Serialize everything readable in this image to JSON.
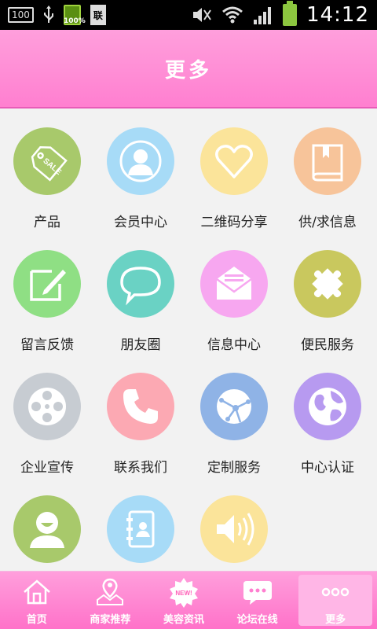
{
  "status_bar": {
    "badge": "100",
    "battery_small": "100%",
    "doc_label": "联",
    "time": "14:12"
  },
  "header": {
    "title": "更多"
  },
  "grid": {
    "items": [
      {
        "label": "产品",
        "icon": "price-tag-icon",
        "color": "#a8c96b"
      },
      {
        "label": "会员中心",
        "icon": "person-icon",
        "color": "#a7dbf7"
      },
      {
        "label": "二维码分享",
        "icon": "heart-icon",
        "color": "#fbe49a"
      },
      {
        "label": "供/求信息",
        "icon": "book-icon",
        "color": "#f7c49a"
      },
      {
        "label": "留言反馈",
        "icon": "pencil-note-icon",
        "color": "#8fdf84"
      },
      {
        "label": "朋友圈",
        "icon": "chat-bubble-icon",
        "color": "#6ad2c4"
      },
      {
        "label": "信息中心",
        "icon": "envelope-icon",
        "color": "#f7a7f0"
      },
      {
        "label": "便民服务",
        "icon": "puzzle-icon",
        "color": "#c9c85e"
      },
      {
        "label": "企业宣传",
        "icon": "film-reel-icon",
        "color": "#c7ccd2"
      },
      {
        "label": "联系我们",
        "icon": "phone-icon",
        "color": "#fca9b3"
      },
      {
        "label": "定制服务",
        "icon": "globe-network-icon",
        "color": "#8fb3e6"
      },
      {
        "label": "中心认证",
        "icon": "world-icon",
        "color": "#b79af0"
      },
      {
        "label": "",
        "icon": "smiley-user-icon",
        "color": "#a8c96b"
      },
      {
        "label": "",
        "icon": "contacts-book-icon",
        "color": "#a7dbf7"
      },
      {
        "label": "",
        "icon": "speaker-icon",
        "color": "#fbe49a"
      }
    ]
  },
  "bottom_nav": {
    "items": [
      {
        "label": "首页",
        "icon": "home-icon"
      },
      {
        "label": "商家推荐",
        "icon": "map-pin-icon"
      },
      {
        "label": "美容资讯",
        "icon": "new-badge-icon",
        "badge": "NEW!"
      },
      {
        "label": "论坛在线",
        "icon": "chat-icon"
      },
      {
        "label": "更多",
        "icon": "more-dots-icon"
      }
    ]
  }
}
